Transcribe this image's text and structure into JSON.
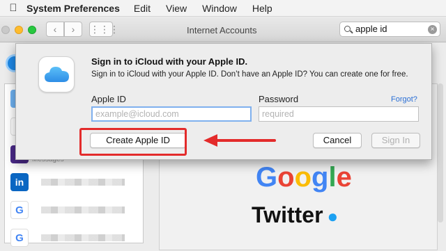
{
  "menubar": {
    "app_name": "System Preferences",
    "items": [
      "Edit",
      "View",
      "Window",
      "Help"
    ]
  },
  "toolbar": {
    "window_title": "Internet Accounts",
    "search_value": "apple id"
  },
  "sheet": {
    "title": "Sign in to iCloud with your Apple ID.",
    "subtitle": "Sign in to iCloud with your Apple ID. Don’t have an Apple ID? You can create one for free.",
    "apple_id_label": "Apple ID",
    "apple_id_placeholder": "example@icloud.com",
    "password_label": "Password",
    "password_placeholder": "required",
    "forgot_label": "Forgot?",
    "create_button": "Create Apple ID",
    "cancel_button": "Cancel",
    "signin_button": "Sign In"
  },
  "background": {
    "partial_label": "Messages",
    "provider_google": "Google",
    "provider_twitter": "Twitter"
  },
  "colors": {
    "annotation": "#e32b2b",
    "link": "#2a6fd6",
    "focus": "#7fb0ee"
  }
}
